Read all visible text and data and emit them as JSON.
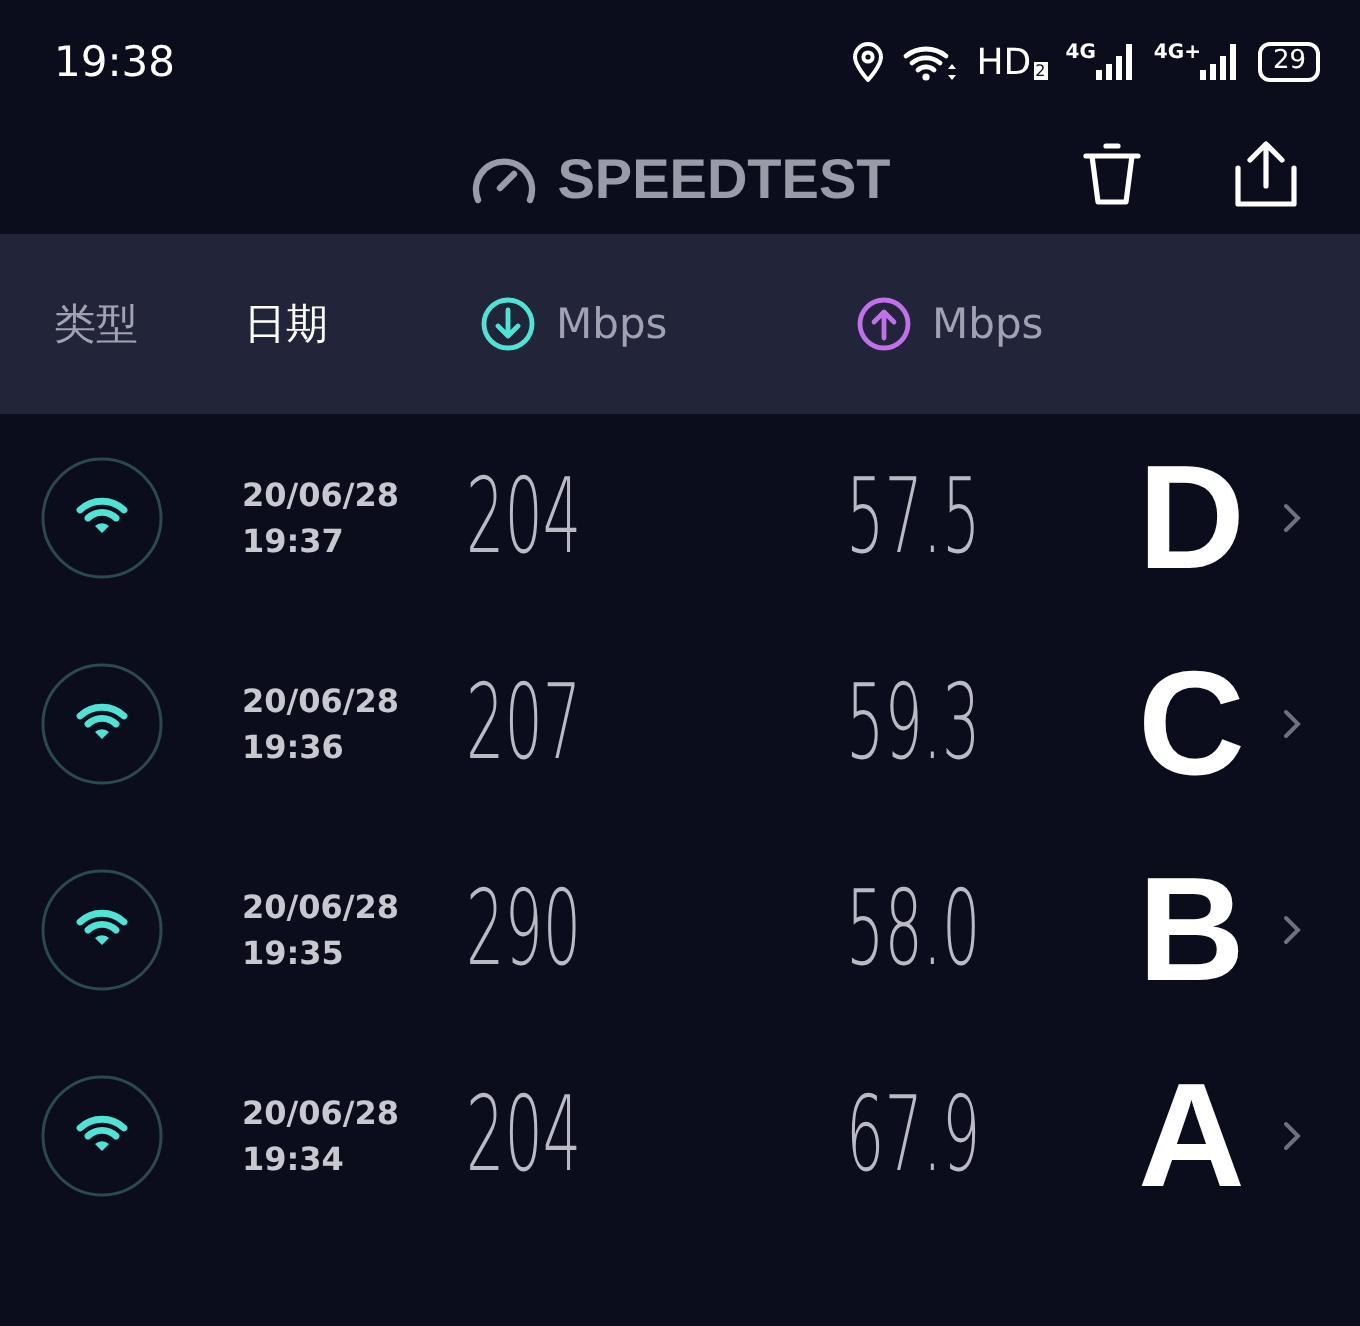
{
  "status_bar": {
    "time": "19:38",
    "hd": "HD",
    "hd_sim": "2",
    "network_1": "4G",
    "network_2": "4G+",
    "battery": "29"
  },
  "header": {
    "title": "SPEEDTEST"
  },
  "columns": [
    {
      "kind": "text",
      "label": "类型",
      "selected": false
    },
    {
      "kind": "text",
      "label": "日期",
      "selected": true
    },
    {
      "kind": "download",
      "label": "Mbps",
      "selected": false
    },
    {
      "kind": "upload",
      "label": "Mbps",
      "selected": false
    }
  ],
  "rows": [
    {
      "date": "20/06/28",
      "time": "19:37",
      "download": "204",
      "upload": "57.5",
      "grade": "D"
    },
    {
      "date": "20/06/28",
      "time": "19:36",
      "download": "207",
      "upload": "59.3",
      "grade": "C"
    },
    {
      "date": "20/06/28",
      "time": "19:35",
      "download": "290",
      "upload": "58.0",
      "grade": "B"
    },
    {
      "date": "20/06/28",
      "time": "19:34",
      "download": "204",
      "upload": "67.9",
      "grade": "A"
    }
  ]
}
